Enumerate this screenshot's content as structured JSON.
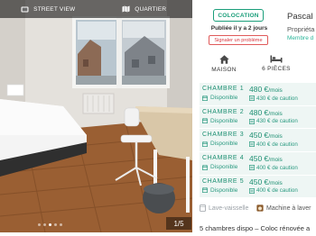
{
  "photo": {
    "tabs": [
      {
        "label": "STREET VIEW",
        "icon": "street-view-icon"
      },
      {
        "label": "QUARTIER",
        "icon": "map-icon"
      }
    ],
    "counter": "1/5",
    "dots": {
      "total": 5,
      "active": 3
    }
  },
  "listing": {
    "type_badge": "COLOCATION",
    "published": "Publiée il y a 2 jours",
    "report_label": "Signaler un problème"
  },
  "owner": {
    "name": "Pascal",
    "role": "Propriéta",
    "since": "Membre d"
  },
  "features": [
    {
      "icon": "house-icon",
      "label": "MAISON"
    },
    {
      "icon": "bed-icon",
      "label": "6 PIÈCES"
    }
  ],
  "rooms": [
    {
      "name": "CHAMBRE 1",
      "status": "Disponible",
      "price": "480 €",
      "unit": "/mois",
      "deposit": "430 € de caution"
    },
    {
      "name": "CHAMBRE 2",
      "status": "Disponible",
      "price": "480 €",
      "unit": "/mois",
      "deposit": "430 € de caution"
    },
    {
      "name": "CHAMBRE 3",
      "status": "Disponible",
      "price": "450 €",
      "unit": "/mois",
      "deposit": "400 € de caution"
    },
    {
      "name": "CHAMBRE 4",
      "status": "Disponible",
      "price": "450 €",
      "unit": "/mois",
      "deposit": "400 € de caution"
    },
    {
      "name": "CHAMBRE 5",
      "status": "Disponible",
      "price": "450 €",
      "unit": "/mois",
      "deposit": "400 € de caution"
    }
  ],
  "amenities": [
    {
      "label": "Lave-vaisselle",
      "icon": "dishwasher-icon",
      "available": false
    },
    {
      "label": "Machine à laver",
      "icon": "washing-machine-icon",
      "available": true
    }
  ],
  "description_title": "5 chambres dispo – Coloc rénovée a",
  "colors": {
    "accent": "#1a9e7a",
    "room_bg": "#eef6f4",
    "report": "#d9363e"
  }
}
